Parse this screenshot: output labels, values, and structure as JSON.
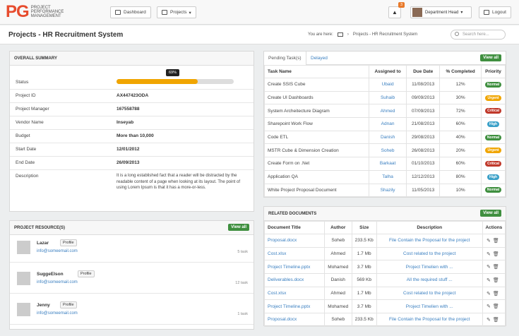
{
  "brand": {
    "initials": "PG",
    "line1": "PROJECT",
    "line2": "PERFORMANCE",
    "line3": "MANAGEMENT"
  },
  "nav": {
    "dashboard": "Dashboard",
    "projects": "Projects",
    "notif_count": "3",
    "user": "Department Head",
    "logout": "Logout"
  },
  "page": {
    "title": "Projects - HR Recruitment System",
    "you_are_here": "You are here:",
    "crumb": "Projects - HR Recruitment System",
    "search_placeholder": "Search here..."
  },
  "summary": {
    "title": "OVERALL SUMMARY",
    "progress_pct": 69,
    "progress_label": "69%",
    "status_k": "Status",
    "id_k": "Project ID",
    "id_v": "AX447423ODA",
    "pm_k": "Project Manager",
    "pm_v": "167558788",
    "vendor_k": "Vendor Name",
    "vendor_v": "Inseyab",
    "budget_k": "Budget",
    "budget_v": "More than 10,000",
    "start_k": "Start Date",
    "start_v": "12/01/2012",
    "end_k": "End Date",
    "end_v": "26/09/2013",
    "desc_k": "Description",
    "desc_v": "It is a long established fact that a reader will be distracted by the readable content of a page when looking at its layout. The point of using Lorem Ipsum is that it has a more-or-less."
  },
  "resources": {
    "title": "PROJECT RESOURCE(S)",
    "view_all": "View all",
    "profile": "Profile",
    "items": [
      {
        "name": "Lazar",
        "email": "info@someemail.com",
        "tasks": "5 task"
      },
      {
        "name": "SuggeElson",
        "email": "info@someemail.com",
        "tasks": "12 task"
      },
      {
        "name": "Jenny",
        "email": "info@someemail.com",
        "tasks": "1 task"
      }
    ]
  },
  "tasks": {
    "tab1": "Pending Task(s)",
    "tab2": "Delayed",
    "view_all": "View all",
    "headers": [
      "Task Name",
      "Assigned to",
      "Due Date",
      "% Completed",
      "Priority"
    ],
    "rows": [
      [
        "Create SSIS Cube",
        "Ubaid",
        "11/08/2013",
        "12%",
        "Normal"
      ],
      [
        "Create UI Dashboards",
        "Suhaib",
        "09/09/2013",
        "30%",
        "Urgent"
      ],
      [
        "System Archeitecture Diagram",
        "Ahmed",
        "07/09/2013",
        "72%",
        "Critical"
      ],
      [
        "Sharepoint Work Flow",
        "Adnan",
        "21/08/2013",
        "60%",
        "High"
      ],
      [
        "Code ETL",
        "Danish",
        "29/08/2013",
        "40%",
        "Normal"
      ],
      [
        "MSTR Cube & Dimension Creation",
        "Soheb",
        "26/08/2013",
        "20%",
        "Urgent"
      ],
      [
        "Create Form on .Net",
        "Barkaat",
        "01/10/2013",
        "60%",
        "Critical"
      ],
      [
        "Application QA",
        "Talha",
        "12/12/2013",
        "80%",
        "High"
      ],
      [
        "White Project Proposal Document",
        "Shazily",
        "11/05/2013",
        "10%",
        "Normal"
      ]
    ],
    "priority_colors": {
      "Normal": "#3f8f3f",
      "Urgent": "#f0a500",
      "Critical": "#c0392b",
      "High": "#3aa0c8"
    }
  },
  "docs": {
    "title": "RELATED DOCUMENTS",
    "view_all": "View all",
    "headers": [
      "Document Title",
      "Author",
      "Size",
      "Description",
      "Actions"
    ],
    "rows": [
      [
        "Proposal.docx",
        "Soheb",
        "233.5 Kb",
        "File Contain the Proposal for the project"
      ],
      [
        "Cost.xlsx",
        "Ahmed",
        "1.7 Mb",
        "Cost related to the project"
      ],
      [
        "Project Timeline.pptx",
        "Mohamed",
        "3.7 Mb",
        "Project Timelien with ..."
      ],
      [
        "Deliverables.docx",
        "Danish",
        "569 Kb",
        "All the required stuff ..."
      ],
      [
        "Cost.xlsx",
        "Ahmed",
        "1.7 Mb",
        "Cost related to the project"
      ],
      [
        "Project Timeline.pptx",
        "Mohamed",
        "3.7 Mb",
        "Project Timelien with ..."
      ],
      [
        "Proposal.docx",
        "Soheb",
        "233.5 Kb",
        "File Contain the Proposal for the project"
      ]
    ]
  }
}
